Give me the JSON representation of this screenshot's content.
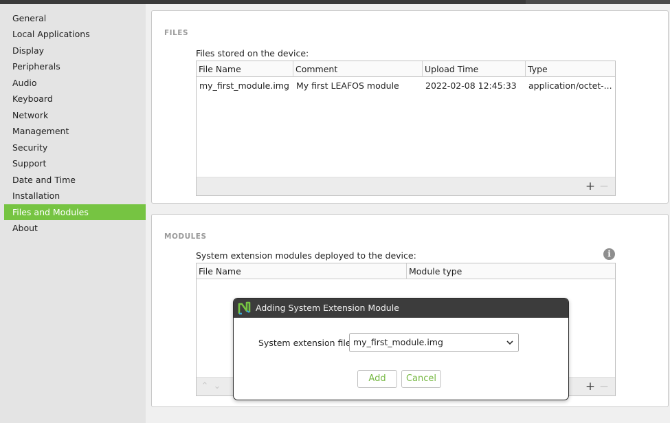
{
  "sidebar": {
    "items": [
      {
        "label": "General"
      },
      {
        "label": "Local Applications"
      },
      {
        "label": "Display"
      },
      {
        "label": "Peripherals"
      },
      {
        "label": "Audio"
      },
      {
        "label": "Keyboard"
      },
      {
        "label": "Network"
      },
      {
        "label": "Management"
      },
      {
        "label": "Security"
      },
      {
        "label": "Support"
      },
      {
        "label": "Date and Time"
      },
      {
        "label": "Installation"
      },
      {
        "label": "Files and Modules"
      },
      {
        "label": "About"
      }
    ],
    "active": "Files and Modules",
    "active_color": "#76c442"
  },
  "files": {
    "title": "FILES",
    "description": "Files stored on the device:",
    "columns": [
      "File Name",
      "Comment",
      "Upload Time",
      "Type"
    ],
    "rows": [
      [
        "my_first_module.img",
        "My first LEAFOS module",
        "2022-02-08 12:45:33",
        "application/octet-..."
      ]
    ],
    "add_icon": "+",
    "remove_icon": "−"
  },
  "modules": {
    "title": "MODULES",
    "description": "System extension modules deployed to the device:",
    "columns": [
      "File Name",
      "Module type"
    ],
    "info_icon": "i",
    "up_icon": "⌃",
    "down_icon": "⌄",
    "add_icon": "+",
    "remove_icon": "−"
  },
  "dialog": {
    "title": "Adding System Extension Module",
    "field_label": "System extension file:",
    "selected_file": "my_first_module.img",
    "add_label": "Add",
    "cancel_label": "Cancel",
    "accent_color": "#76b842"
  }
}
